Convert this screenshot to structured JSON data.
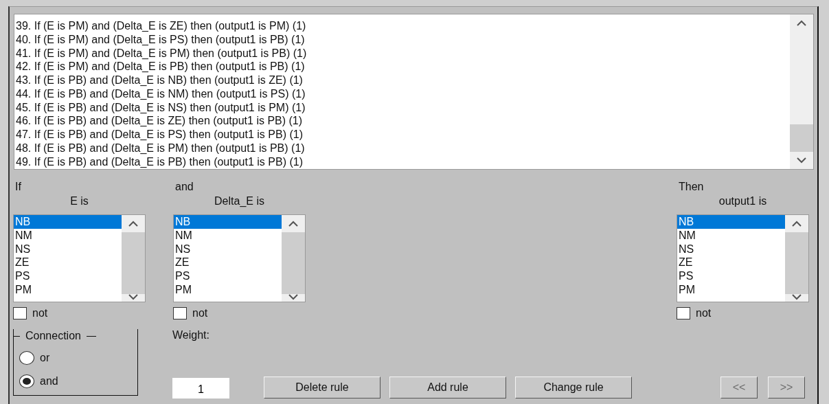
{
  "rules": {
    "items": [
      "39. If (E is PM) and (Delta_E is ZE) then (output1 is PM) (1)",
      "40. If (E is PM) and (Delta_E is PS) then (output1 is PB) (1)",
      "41. If (E is PM) and (Delta_E is PM) then (output1 is PB) (1)",
      "42. If (E is PM) and (Delta_E is PB) then (output1 is PB) (1)",
      "43. If (E is PB) and (Delta_E is NB) then (output1 is ZE) (1)",
      "44. If (E is PB) and (Delta_E is NM) then (output1 is PS) (1)",
      "45. If (E is PB) and (Delta_E is NS) then (output1 is PM) (1)",
      "46. If (E is PB) and (Delta_E is ZE) then (output1 is PB) (1)",
      "47. If (E is PB) and (Delta_E is PS) then (output1 is PB) (1)",
      "48. If (E is PB) and (Delta_E is PM) then (output1 is PB) (1)",
      "49. If (E is PB) and (Delta_E is PB) then (output1 is PB) (1)"
    ]
  },
  "clauses": [
    {
      "kind": "antecedent",
      "heading": "If",
      "label": "E is",
      "not_label": "not",
      "not_checked": false,
      "options": [
        {
          "label": "NB",
          "selected": true
        },
        {
          "label": "NM",
          "selected": false
        },
        {
          "label": "NS",
          "selected": false
        },
        {
          "label": "ZE",
          "selected": false
        },
        {
          "label": "PS",
          "selected": false
        },
        {
          "label": "PM",
          "selected": false
        }
      ]
    },
    {
      "kind": "antecedent",
      "heading": "and",
      "label": "Delta_E is",
      "not_label": "not",
      "not_checked": false,
      "options": [
        {
          "label": "NB",
          "selected": true
        },
        {
          "label": "NM",
          "selected": false
        },
        {
          "label": "NS",
          "selected": false
        },
        {
          "label": "ZE",
          "selected": false
        },
        {
          "label": "PS",
          "selected": false
        },
        {
          "label": "PM",
          "selected": false
        }
      ]
    },
    {
      "kind": "consequent",
      "heading": "Then",
      "label": "output1 is",
      "not_label": "not",
      "not_checked": false,
      "options": [
        {
          "label": "NB",
          "selected": true
        },
        {
          "label": "NM",
          "selected": false
        },
        {
          "label": "NS",
          "selected": false
        },
        {
          "label": "ZE",
          "selected": false
        },
        {
          "label": "PS",
          "selected": false
        },
        {
          "label": "PM",
          "selected": false
        }
      ]
    }
  ],
  "connection": {
    "title": "Connection",
    "options": [
      {
        "label": "or",
        "selected": false
      },
      {
        "label": "and",
        "selected": true
      }
    ]
  },
  "weight": {
    "label": "Weight:",
    "value": "1"
  },
  "buttons": [
    {
      "kind": "action",
      "label": "Delete rule",
      "disabled": false
    },
    {
      "kind": "action",
      "label": "Add rule",
      "disabled": false
    },
    {
      "kind": "action",
      "label": "Change rule",
      "disabled": false
    },
    {
      "kind": "nav",
      "label": "<<",
      "disabled": true
    },
    {
      "kind": "nav",
      "label": ">>",
      "disabled": true
    }
  ]
}
